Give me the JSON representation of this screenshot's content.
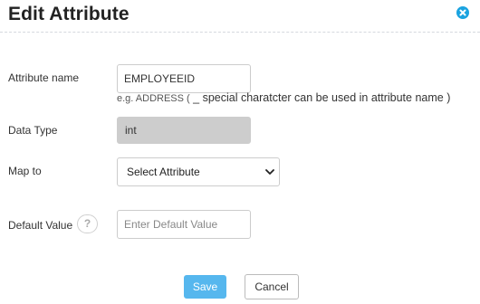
{
  "dialog": {
    "title": "Edit Attribute",
    "close_icon": "close-icon",
    "accent_color": "#1aa3e0"
  },
  "form": {
    "attribute_name": {
      "label": "Attribute name",
      "value": "EMPLOYEEID",
      "hint_prefix": "e.g. ADDRESS (",
      "hint_main": " _ special charatcter can be used in attribute name )"
    },
    "data_type": {
      "label": "Data Type",
      "value": "int"
    },
    "map_to": {
      "label": "Map to",
      "selected": "Select Attribute"
    },
    "default_value": {
      "label": "Default Value",
      "help_glyph": "?",
      "placeholder": "Enter Default Value"
    }
  },
  "buttons": {
    "save_label": "Save",
    "cancel_label": "Cancel",
    "save_color": "#56b7ee"
  }
}
